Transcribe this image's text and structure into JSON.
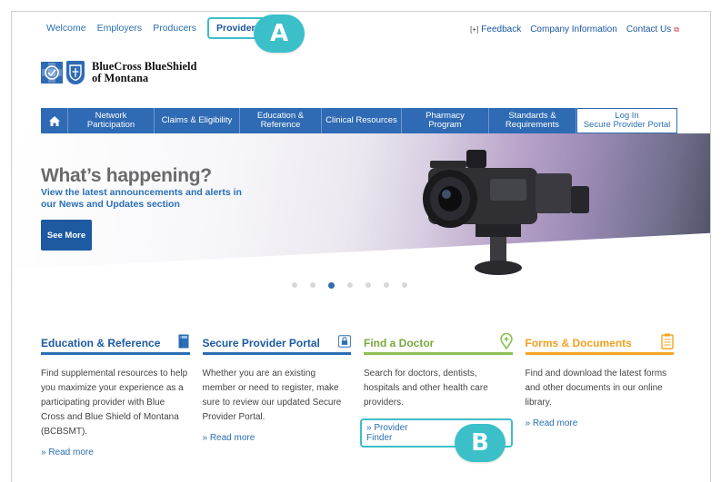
{
  "audience_nav": {
    "items": [
      "Welcome",
      "Employers",
      "Producers",
      "Providers"
    ],
    "active": "Providers"
  },
  "utility_nav": {
    "feedback": "Feedback",
    "company_info": "Company Information",
    "contact": "Contact Us"
  },
  "callouts": {
    "a": "A",
    "b": "B"
  },
  "logo": {
    "line1": "BlueCross BlueShield",
    "line2": "of Montana"
  },
  "main_menu": {
    "home_icon": "home-icon",
    "items": [
      {
        "line1": "Network",
        "line2": "Participation"
      },
      {
        "line1": "Claims & Eligibility",
        "line2": ""
      },
      {
        "line1": "Education &",
        "line2": "Reference"
      },
      {
        "line1": "Clinical Resources",
        "line2": ""
      },
      {
        "line1": "Pharmacy",
        "line2": "Program"
      },
      {
        "line1": "Standards &",
        "line2": "Requirements"
      }
    ],
    "login": {
      "line1": "Log In",
      "line2": "Secure Provider Portal"
    }
  },
  "hero": {
    "title": "What’s happening?",
    "subtitle": "View the latest announcements and alerts in our News and Updates section",
    "button": "See More",
    "slide_count": 7,
    "active_slide": 3
  },
  "features": [
    {
      "title": "Education & Reference",
      "icon": "book-icon",
      "body": "Find supplemental resources to help you maximize your experience as a participating provider with Blue Cross and Blue Shield of Montana (BCBSMT).",
      "link": "» Read more"
    },
    {
      "title": "Secure Provider Portal",
      "icon": "lock-icon",
      "body": "Whether you are an existing member or need to register, make sure to review our updated Secure Provider Portal.",
      "link": "» Read more"
    },
    {
      "title": "Find a Doctor",
      "icon": "location-pin-icon",
      "body": "Search for doctors, dentists, hospitals and other health care providers.",
      "link": "» Provider Finder"
    },
    {
      "title": "Forms & Documents",
      "icon": "clipboard-icon",
      "body": "Find and download the latest forms and other documents in our online library.",
      "link": "» Read more"
    }
  ],
  "colors": {
    "brand_blue": "#2f6ab4",
    "callout_teal": "#3bbfc9",
    "green": "#8cc152",
    "orange": "#f5a623"
  }
}
